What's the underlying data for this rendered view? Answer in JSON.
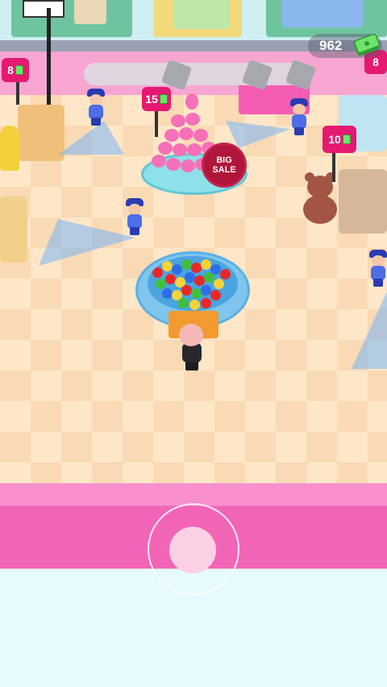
{
  "hud": {
    "money_value": "962",
    "money_icon": "cash-stack-icon",
    "stage_progress": 0.0
  },
  "signs": {
    "top_left_price": "8",
    "center_price": "15",
    "right_price": "10",
    "far_right_price": "8"
  },
  "promo": {
    "big_sale_line1": "BIG",
    "big_sale_line2": "SALE"
  },
  "colors": {
    "accent_pink": "#f265b6",
    "price_sign": "#e4196f",
    "big_sale_badge": "#b0153b",
    "guard_uniform": "#4e6de6",
    "money_green": "#6ee36a"
  },
  "icons": {
    "money": "cash-stack-icon",
    "bill": "dollar-bill-icon",
    "joystick": "virtual-joystick"
  }
}
